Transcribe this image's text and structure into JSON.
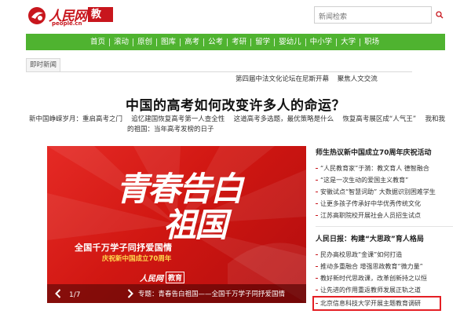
{
  "header": {
    "logo_text": "人民网",
    "logo_url": "people.cn",
    "channel": "教育",
    "brand_color": "#c8161d",
    "search": {
      "placeholder": "新闻检索",
      "icon": "search-icon"
    }
  },
  "nav": {
    "color": "#4fb330",
    "items": [
      "首页",
      "滚动",
      "原创",
      "图库",
      "高考",
      "公考",
      "考研",
      "留学",
      "婴幼儿",
      "中小学",
      "大学",
      "职场"
    ]
  },
  "ticker": {
    "label": "即时新闻",
    "items": [
      "第四届中法文化论坛在尼斯开幕",
      "聚焦人文交流"
    ]
  },
  "headline": {
    "title": "中国的高考如何改变许多人的命运？",
    "links_row1": [
      "新中国峥嵘岁月：重启高考之门",
      "追忆建国恢复高考第一人查全性",
      "这道高考多选题，最优策略是什么",
      "恢复高考展区成“人气王”",
      "我和我"
    ],
    "links_row2": [
      "的祖国：当年高考发榜的日子"
    ]
  },
  "hero": {
    "title_line1": "青春告白",
    "title_line2": "祖国",
    "subtitle": "全国千万学子同抒爱国情",
    "subtitle2": "庆祝新中国成立70周年",
    "logo_text": "人民网",
    "logo_channel": "教育",
    "page_current": "1",
    "page_total": "7",
    "caption": "专题：青春告白祖国——全国千万学子同抒爱国情",
    "accent_color": "#d11712"
  },
  "sidebar": {
    "section1": {
      "title": "师生热议新中国成立70周年庆祝活动",
      "items": [
        "“人民教育家”于漪：教文育人 德智融合",
        "“这是一次生动的爱国主义教育”",
        "安徽试点“智慧词助” 大数据识别困难学生",
        "让更多孩子传承好中华优秀传统文化",
        "江苏高职院校开展社会人员招生试点"
      ]
    },
    "section2": {
      "title": "人民日报：构建“大思政”育人格局",
      "items": [
        "民办高校思政“金课”如何打造",
        "推动多重融合 增强思政教育“微力量”",
        "教好新时代思政课，改革创新持之以恒",
        "让先进的作用重返教师发展正轨之道",
        "北京信息科技大学开展主题教育调研"
      ]
    }
  }
}
